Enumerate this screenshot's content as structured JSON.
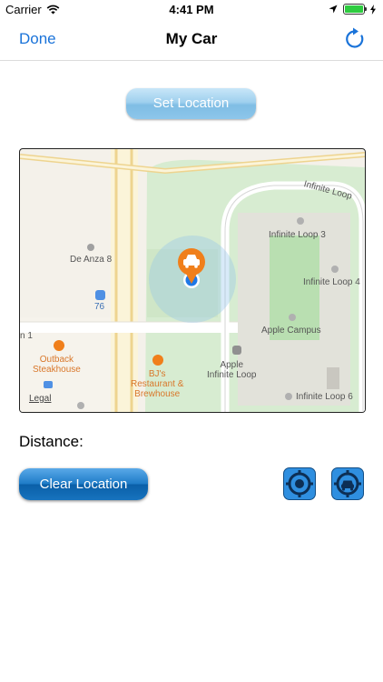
{
  "status_bar": {
    "carrier": "Carrier",
    "time": "4:41 PM"
  },
  "nav": {
    "done_label": "Done",
    "title": "My Car"
  },
  "buttons": {
    "set_location": "Set Location",
    "clear_location": "Clear Location"
  },
  "map": {
    "labels": {
      "de_anza": "De Anza 8",
      "route_number": "76",
      "infinite_loop_3": "Infinite Loop 3",
      "infinite_loop_4": "Infinite Loop 4",
      "infinite_loop_street": "Infinite Loop",
      "apple_campus": "Apple Campus",
      "apple_infinite_loop": "Apple\nInfinite Loop",
      "infinite_loop_6": "Infinite Loop 6",
      "outback": "Outback\nSteakhouse",
      "bjs": "BJ's\nRestaurant &\nBrewhouse",
      "n1": "n 1",
      "legal": "Legal"
    }
  },
  "distance_label": "Distance:",
  "colors": {
    "accent": "#1a73d9",
    "car_pin": "#f07f1b",
    "user_dot": "#1e78e6"
  }
}
